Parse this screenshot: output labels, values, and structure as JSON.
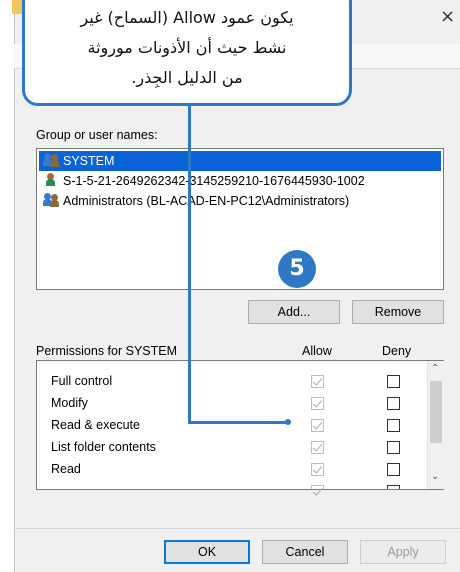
{
  "callout": {
    "lines": [
      "يكون عمود Allow (السماح) غير",
      "نشط حيث أن الأذونات موروثة",
      "من الدليل الجِذر."
    ]
  },
  "badge": {
    "step": "5"
  },
  "window": {
    "close_glyph": "×"
  },
  "groups": {
    "label": "Group or user names:",
    "items": [
      {
        "name": "SYSTEM",
        "icon": "users-icon",
        "selected": true
      },
      {
        "name": "S-1-5-21-2649262342-3145259210-1676445930-1002",
        "icon": "user-icon",
        "selected": false
      },
      {
        "name": "Administrators (BL-ACAD-EN-PC12\\Administrators)",
        "icon": "users-icon",
        "selected": false
      }
    ],
    "add_label": "Add...",
    "remove_label": "Remove"
  },
  "permissions": {
    "label": "Permissions for SYSTEM",
    "allow_header": "Allow",
    "deny_header": "Deny",
    "rows": [
      {
        "name": "Full control",
        "allow": true,
        "deny": false
      },
      {
        "name": "Modify",
        "allow": true,
        "deny": false
      },
      {
        "name": "Read & execute",
        "allow": true,
        "deny": false
      },
      {
        "name": "List folder contents",
        "allow": true,
        "deny": false
      },
      {
        "name": "Read",
        "allow": true,
        "deny": false
      }
    ]
  },
  "footer": {
    "ok_label": "OK",
    "cancel_label": "Cancel",
    "apply_label": "Apply"
  },
  "colors": {
    "accent": "#2f78c7",
    "selection": "#0a64d8"
  }
}
